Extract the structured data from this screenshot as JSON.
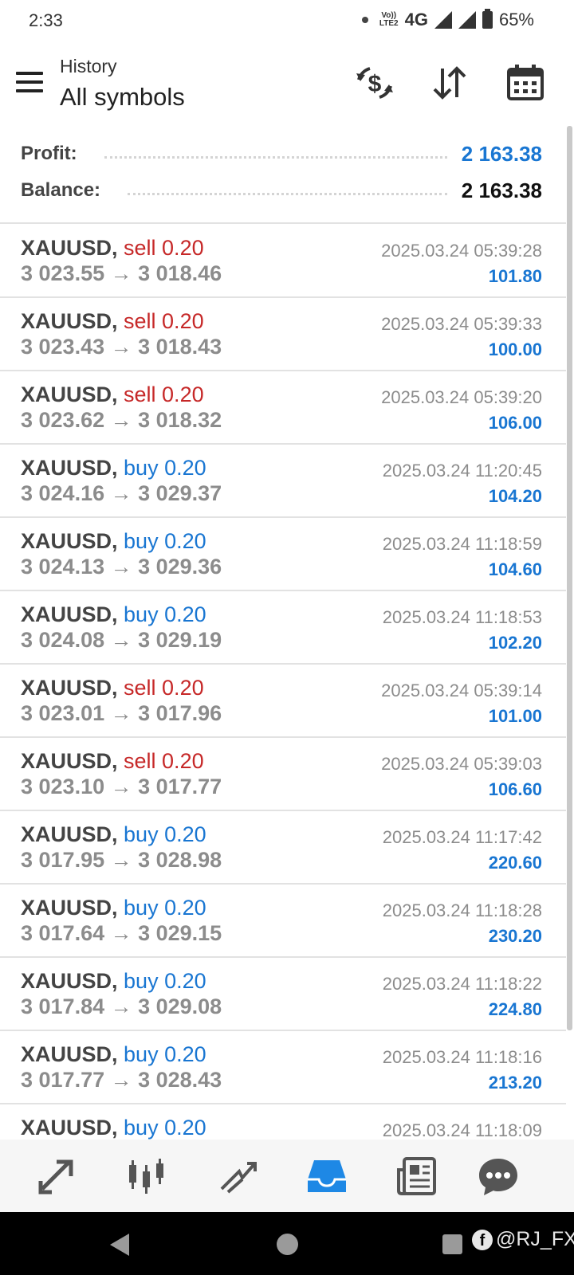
{
  "status_bar": {
    "time": "2:33",
    "network": "4G",
    "volte": "Vo)) LTE2",
    "battery": "65%"
  },
  "header": {
    "subtitle": "History",
    "title": "All symbols",
    "icons": [
      "currency-exchange-icon",
      "sort-icon",
      "calendar-icon"
    ]
  },
  "summary": {
    "profit_label": "Profit:",
    "profit_value": "2 163.38",
    "balance_label": "Balance:",
    "balance_value": "2 163.38"
  },
  "deals": [
    {
      "symbol": "XAUUSD,",
      "side": "sell",
      "side_text": "sell 0.20",
      "prices": "3 023.55 → 3 018.46",
      "time": "2025.03.24 05:39:28",
      "profit": "101.80"
    },
    {
      "symbol": "XAUUSD,",
      "side": "sell",
      "side_text": "sell 0.20",
      "prices": "3 023.43 → 3 018.43",
      "time": "2025.03.24 05:39:33",
      "profit": "100.00"
    },
    {
      "symbol": "XAUUSD,",
      "side": "sell",
      "side_text": "sell 0.20",
      "prices": "3 023.62 → 3 018.32",
      "time": "2025.03.24 05:39:20",
      "profit": "106.00"
    },
    {
      "symbol": "XAUUSD,",
      "side": "buy",
      "side_text": "buy 0.20",
      "prices": "3 024.16 → 3 029.37",
      "time": "2025.03.24 11:20:45",
      "profit": "104.20"
    },
    {
      "symbol": "XAUUSD,",
      "side": "buy",
      "side_text": "buy 0.20",
      "prices": "3 024.13 → 3 029.36",
      "time": "2025.03.24 11:18:59",
      "profit": "104.60"
    },
    {
      "symbol": "XAUUSD,",
      "side": "buy",
      "side_text": "buy 0.20",
      "prices": "3 024.08 → 3 029.19",
      "time": "2025.03.24 11:18:53",
      "profit": "102.20"
    },
    {
      "symbol": "XAUUSD,",
      "side": "sell",
      "side_text": "sell 0.20",
      "prices": "3 023.01 → 3 017.96",
      "time": "2025.03.24 05:39:14",
      "profit": "101.00"
    },
    {
      "symbol": "XAUUSD,",
      "side": "sell",
      "side_text": "sell 0.20",
      "prices": "3 023.10 → 3 017.77",
      "time": "2025.03.24 05:39:03",
      "profit": "106.60"
    },
    {
      "symbol": "XAUUSD,",
      "side": "buy",
      "side_text": "buy 0.20",
      "prices": "3 017.95 → 3 028.98",
      "time": "2025.03.24 11:17:42",
      "profit": "220.60"
    },
    {
      "symbol": "XAUUSD,",
      "side": "buy",
      "side_text": "buy 0.20",
      "prices": "3 017.64 → 3 029.15",
      "time": "2025.03.24 11:18:28",
      "profit": "230.20"
    },
    {
      "symbol": "XAUUSD,",
      "side": "buy",
      "side_text": "buy 0.20",
      "prices": "3 017.84 → 3 029.08",
      "time": "2025.03.24 11:18:22",
      "profit": "224.80"
    },
    {
      "symbol": "XAUUSD,",
      "side": "buy",
      "side_text": "buy 0.20",
      "prices": "3 017.77 → 3 028.43",
      "time": "2025.03.24 11:18:16",
      "profit": "213.20"
    },
    {
      "symbol": "XAUUSD,",
      "side": "buy",
      "side_text": "buy 0.20",
      "prices": "",
      "time": "2025.03.24 11:18:09",
      "profit": ""
    }
  ],
  "bottom_nav": {
    "items": [
      "quotes-icon",
      "chart-icon",
      "trade-icon",
      "history-icon",
      "news-icon",
      "messages-icon"
    ],
    "active": "history-icon"
  },
  "colors": {
    "accent": "#1976d2",
    "sell": "#c62828",
    "buy": "#1976d2",
    "muted": "#8c8c8c"
  },
  "watermark": "@RJ_FX"
}
